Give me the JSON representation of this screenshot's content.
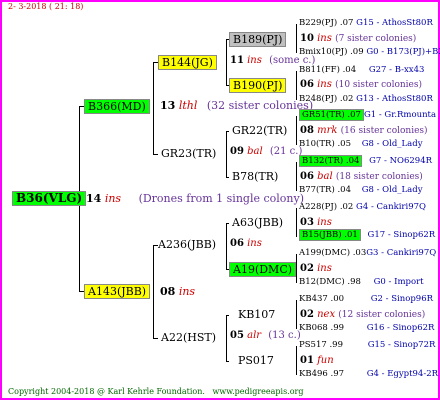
{
  "header": {
    "date": "2-  3-2018 ( 21: 18)"
  },
  "footer": {
    "copyright": "Copyright 2004-2018 @ Karl Kehrle Foundation.",
    "site": "www.pedigreeapis.org"
  },
  "root": {
    "label": "B36(VLG)",
    "num": "14",
    "abbr": "ins",
    "desc": "(Drones from 1 single colony)"
  },
  "gen1": [
    {
      "label": "B366(MD)",
      "num": "13",
      "abbr": "lthl",
      "desc": "(32 sister colonies)"
    },
    {
      "label": "A143(JBB)",
      "num": "08",
      "abbr": "ins"
    }
  ],
  "gen2": [
    {
      "label": "B144(JG)",
      "num": "11",
      "abbr": "ins",
      "desc": "(some c.)"
    },
    {
      "label": "GR23(TR)",
      "num": "09",
      "abbr": "bal",
      "desc": "(21 c.)"
    },
    {
      "label": "A236(JBB)",
      "num": "06",
      "abbr": "ins"
    },
    {
      "label": "A22(HST)",
      "num": "05",
      "abbr": "alr",
      "desc": "(13 c.)"
    }
  ],
  "gen3": [
    {
      "label": "B189(PJ)",
      "num": "10",
      "abbr": "ins",
      "desc": "(7 sister colonies)"
    },
    {
      "label": "B190(PJ)",
      "num": "06",
      "abbr": "ins",
      "desc": "(10 sister colonies)"
    },
    {
      "label": "GR22(TR)",
      "num": "08",
      "abbr": "mrk",
      "desc": "(16 sister colonies)"
    },
    {
      "label": "B78(TR)",
      "num": "06",
      "abbr": "bal",
      "desc": "(18 sister colonies)"
    },
    {
      "label": "A63(JBB)",
      "num": "03",
      "abbr": "ins"
    },
    {
      "label": "A19(DMC)",
      "num": "02",
      "abbr": "ins"
    },
    {
      "label": "KB107",
      "num": "02",
      "abbr": "nex",
      "desc": "(12 sister colonies)"
    },
    {
      "label": "PS017",
      "num": "01",
      "abbr": "fun"
    }
  ],
  "gen4": [
    {
      "label": "B229(PJ) .07",
      "ref": "G15 - AthosSt80R"
    },
    {
      "label": "Bmix10(PJ) .09",
      "ref": "G0 - B173(PJ)+B2"
    },
    {
      "label": "B811(FF) .04",
      "ref": "G27 - B-xx43"
    },
    {
      "label": "B248(PJ) .02",
      "ref": "G13 - AthosSt80R"
    },
    {
      "label": "GR51(TR) .07",
      "ref": "G1 - Gr.Rmounta"
    },
    {
      "label": "B10(TR) .05",
      "ref": "G8 - Old_Lady"
    },
    {
      "label": "B132(TR) .04",
      "ref": "G7 - NO6294R"
    },
    {
      "label": "B77(TR) .04",
      "ref": "G8 - Old_Lady"
    },
    {
      "label": "A228(PJ) .02",
      "ref": "G4 - Cankiri97Q"
    },
    {
      "label": "B15(JBB) .01",
      "ref": "G17 - Sinop62R"
    },
    {
      "label": "A199(DMC) .03",
      "ref": "G3 - Cankiri97Q"
    },
    {
      "label": "B12(DMC) .98",
      "ref": "G0 - Import"
    },
    {
      "label": "KB437 .00",
      "ref": "G2 - Sinop96R"
    },
    {
      "label": "KB068 .99",
      "ref": "G16 - Sinop62R"
    },
    {
      "label": "PS517 .99",
      "ref": "G15 - Sinop72R"
    },
    {
      "label": "KB496 .97",
      "ref": "G4 - Egypt94-2R"
    }
  ]
}
